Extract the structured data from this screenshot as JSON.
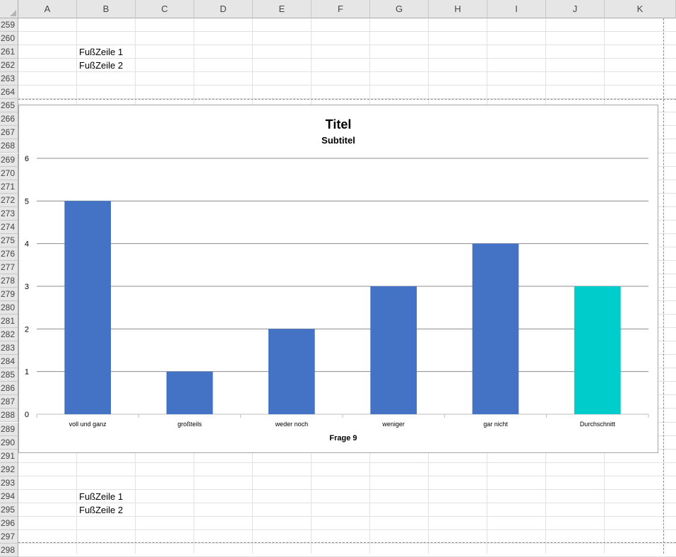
{
  "sheet": {
    "columns": [
      "A",
      "B",
      "C",
      "D",
      "E",
      "F",
      "G",
      "H",
      "I",
      "J",
      "K"
    ],
    "rows": [
      259,
      260,
      261,
      262,
      263,
      264,
      265,
      266,
      267,
      268,
      269,
      270,
      271,
      272,
      273,
      274,
      275,
      276,
      277,
      278,
      279,
      280,
      281,
      282,
      283,
      284,
      285,
      286,
      287,
      288,
      289,
      290,
      291,
      292,
      293,
      294,
      295,
      296,
      297,
      298
    ],
    "cells": [
      {
        "row": 261,
        "col": "B",
        "text": "FußZeile 1"
      },
      {
        "row": 262,
        "col": "B",
        "text": "FußZeile 2"
      },
      {
        "row": 294,
        "col": "B",
        "text": "FußZeile 1"
      },
      {
        "row": 295,
        "col": "B",
        "text": "FußZeile 2"
      }
    ]
  },
  "chart_data": {
    "type": "bar",
    "title": "Titel",
    "subtitle": "Subtitel",
    "xlabel": "Frage 9",
    "ylabel": "",
    "categories": [
      "voll und ganz",
      "großteils",
      "weder noch",
      "weniger",
      "gar nicht",
      "Durchschnitt"
    ],
    "values": [
      5,
      1,
      2,
      3,
      4,
      3
    ],
    "colors": [
      "#4472c4",
      "#4472c4",
      "#4472c4",
      "#4472c4",
      "#4472c4",
      "#00cccc"
    ],
    "ylim": [
      0,
      6
    ],
    "yticks": [
      0,
      1,
      2,
      3,
      4,
      5,
      6
    ],
    "grid": true,
    "legend": "none"
  }
}
